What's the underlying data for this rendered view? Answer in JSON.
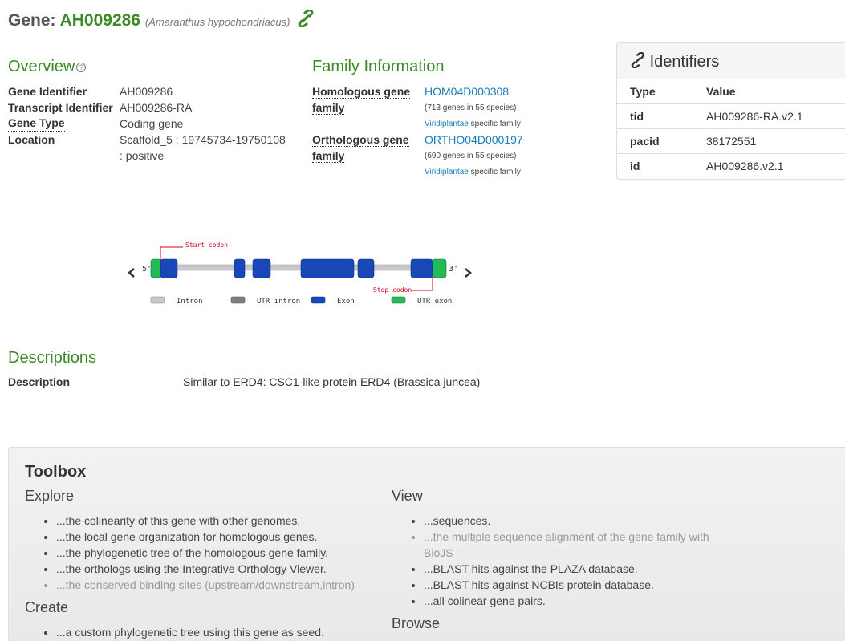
{
  "header": {
    "prefix": "Gene:",
    "gene_id": "AH009286",
    "species": "(Amaranthus hypochondriacus)",
    "link_icon": "link-icon"
  },
  "overview": {
    "title": "Overview",
    "help_icon": "?",
    "rows": [
      {
        "key": "Gene Identifier",
        "value": "AH009286"
      },
      {
        "key": "Transcript Identifier",
        "value": "AH009286-RA"
      },
      {
        "key": "Gene Type",
        "value": "Coding gene"
      },
      {
        "key": "Location",
        "value": "Scaffold_5 : 19745734-19750108",
        "value2": ": positive"
      }
    ]
  },
  "family": {
    "title": "Family Information",
    "homologous": {
      "key_line1": "Homologous gene",
      "key_line2": "family",
      "id": "HOM04D000308",
      "count": "(713 genes in 55 species)",
      "clade": "Viridiplantae",
      "clade_suffix": "specific family"
    },
    "orthologous": {
      "key_line1": "Orthologous gene",
      "key_line2": "family",
      "id": "ORTHO04D000197",
      "count": "(690 genes in 55 species)",
      "clade": "Viridiplantae",
      "clade_suffix": "specific family"
    }
  },
  "identifiers": {
    "title": "Identifiers",
    "columns": [
      "Type",
      "Value"
    ],
    "rows": [
      {
        "type": "tid",
        "value": "AH009286-RA.v2.1"
      },
      {
        "type": "pacid",
        "value": "38172551"
      },
      {
        "type": "id",
        "value": "AH009286.v2.1"
      }
    ]
  },
  "gene_structure": {
    "start_label": "Start codon",
    "stop_label": "Stop codon",
    "five_prime": "5'",
    "three_prime": "3'",
    "legend": [
      "Intron",
      "UTR intron",
      "Exon",
      "UTR exon"
    ],
    "colors": {
      "exon": "#1947b8",
      "utr_exon": "#22bb55",
      "intron": "#c8c8c8",
      "utr_intron": "#7a8080",
      "codon": "#d0021b"
    }
  },
  "descriptions": {
    "title": "Descriptions",
    "key": "Description",
    "value": "Similar to ERD4: CSC1-like protein ERD4 (Brassica juncea)"
  },
  "toolbox": {
    "title": "Toolbox",
    "explore_title": "Explore",
    "explore": [
      {
        "text": "...the colinearity of this gene with other genomes.",
        "enabled": true
      },
      {
        "text": "...the local gene organization for homologous genes.",
        "enabled": true
      },
      {
        "text": "...the phylogenetic tree of the homologous gene family.",
        "enabled": true
      },
      {
        "text": "...the orthologs using the Integrative Orthology Viewer.",
        "enabled": true
      },
      {
        "text": "...the conserved binding sites (upstream/downstream,intron)",
        "enabled": false
      }
    ],
    "create_title": "Create",
    "create": [
      {
        "text": "...a custom phylogenetic tree using this gene as seed.",
        "enabled": true
      }
    ],
    "view_title": "View",
    "view": [
      {
        "text": "...sequences.",
        "enabled": true
      },
      {
        "text": "...the multiple sequence alignment of the gene family with BioJS",
        "enabled": false
      },
      {
        "text": "...BLAST hits against the PLAZA database.",
        "enabled": true
      },
      {
        "text": "...BLAST hits against NCBIs protein database.",
        "enabled": true
      },
      {
        "text": "...all colinear gene pairs.",
        "enabled": true
      }
    ],
    "browse_title": "Browse"
  }
}
